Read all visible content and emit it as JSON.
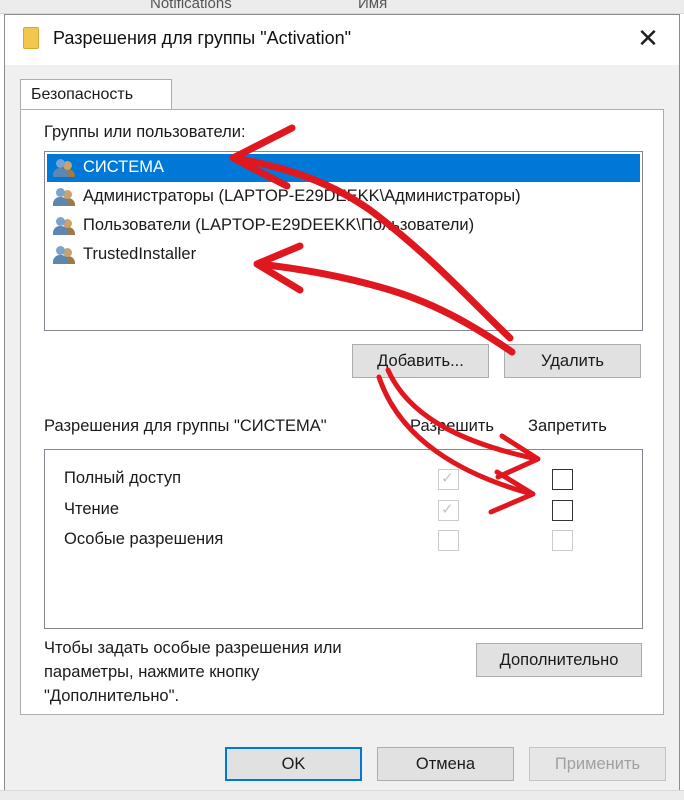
{
  "background": {
    "top_text_left": "Notifications",
    "top_text_right": "Имя"
  },
  "dialog": {
    "title": "Разрешения для группы \"Activation\"",
    "close_label": "✕",
    "tab": "Безопасность",
    "groups_label": "Группы или пользователи:",
    "users": [
      {
        "name": "СИСТЕМА",
        "selected": true
      },
      {
        "name": "Администраторы (LAPTOP-E29DEEKK\\Администраторы)",
        "selected": false
      },
      {
        "name": "Пользователи (LAPTOP-E29DEEKK\\Пользователи)",
        "selected": false
      },
      {
        "name": "TrustedInstaller",
        "selected": false
      }
    ],
    "add_button": "Добавить...",
    "remove_button": "Удалить",
    "permissions_label": "Разрешения для группы \"СИСТЕМА\"",
    "allow_header": "Разрешить",
    "deny_header": "Запретить",
    "permissions": [
      {
        "name": "Полный доступ",
        "allow": true,
        "deny": false
      },
      {
        "name": "Чтение",
        "allow": true,
        "deny": false
      },
      {
        "name": "Особые разрешения",
        "allow": false,
        "deny": false
      }
    ],
    "advanced_hint": "Чтобы задать особые разрешения или параметры, нажмите кнопку \"Дополнительно\".",
    "advanced_hint_lines": [
      "Чтобы задать особые разрешения или",
      "параметры, нажмите кнопку",
      "\"Дополнительно\"."
    ],
    "advanced_button": "Дополнительно",
    "ok_button": "OK",
    "cancel_button": "Отмена",
    "apply_button": "Применить"
  },
  "colors": {
    "selection": "#0078d7",
    "annotation_arrow": "#e0171f"
  },
  "icons": {
    "title": "folder-icon",
    "user": "users-group-icon",
    "close": "close-icon"
  }
}
